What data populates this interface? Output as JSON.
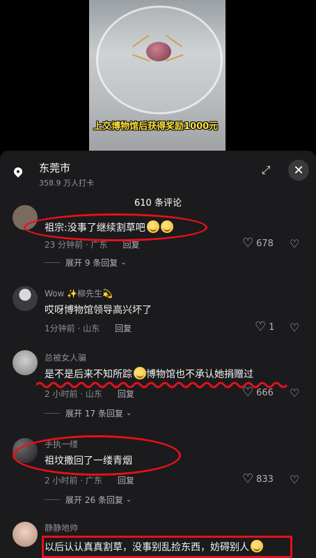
{
  "video": {
    "caption": "上交博物馆后获得奖励1000元"
  },
  "location": {
    "name": "东莞市",
    "checkins": "358.9 万人打卡",
    "icons": {
      "pin": "location-pin-icon",
      "expand": "expand-icon",
      "close": "close-icon"
    }
  },
  "comments_header": "610 条评论",
  "comments": [
    {
      "username": "",
      "text": "祖宗:没事了继续割草吧",
      "time_loc": "23 分钟前 · 广东",
      "reply_label": "回复",
      "likes": "678",
      "expand_label": "展开 9 条回复"
    },
    {
      "username": "Wow ✨柳先生💫",
      "text": "哎呀博物馆领导高兴坏了",
      "time_loc": "1分钟前 · 山东",
      "reply_label": "回复",
      "likes": "1"
    },
    {
      "username": "总被女人骗",
      "text_before": "是不是后来不知所踪",
      "text_after": "博物馆也不承认她捐赠过",
      "time_loc": "2 小时前 · 山东",
      "reply_label": "回复",
      "likes": "666",
      "expand_label": "展开 17 条回复"
    },
    {
      "username": "手执一缕",
      "text": "祖坟撒回了一缕青烟",
      "time_loc": "2 小时前 · 广东",
      "reply_label": "回复",
      "likes": "833",
      "expand_label": "展开 26 条回复"
    },
    {
      "username": "静静地帅",
      "text": "以后认认真真割草，没事别乱捡东西，妨碍别人"
    }
  ],
  "colors": {
    "annotation_red": "#e8101a",
    "sheet_bg": "#1b1b1d",
    "caption_yellow": "#ffe33a"
  }
}
